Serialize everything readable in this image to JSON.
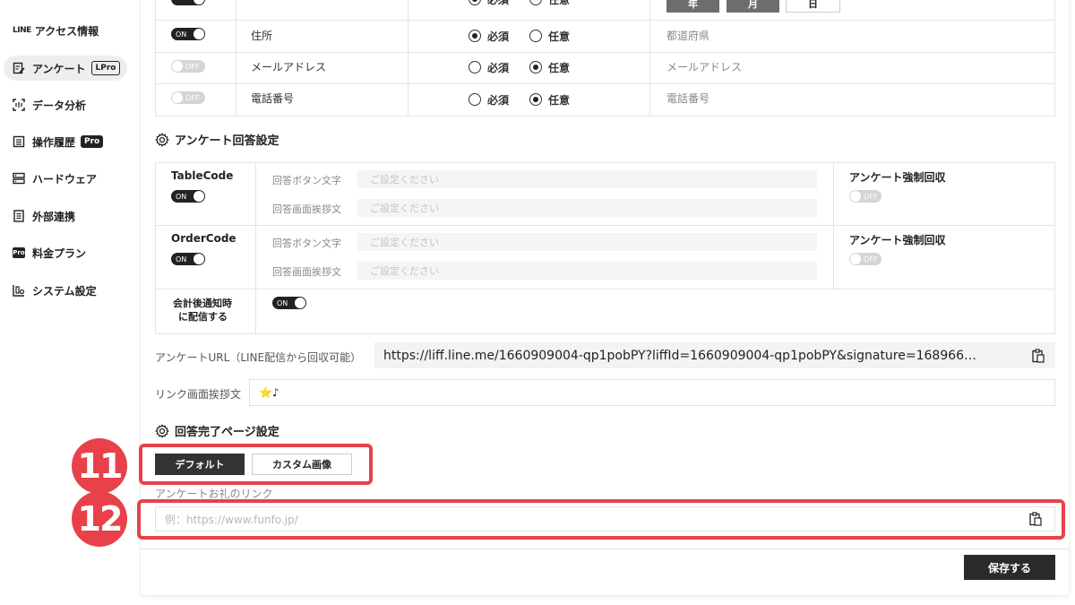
{
  "sidebar": {
    "items": [
      {
        "label": "アクセス情報",
        "logo": "LINE"
      },
      {
        "label": "アンケート",
        "badge": "LPro"
      },
      {
        "label": "データ分析"
      },
      {
        "label": "操作履歴",
        "badge": "Pro"
      },
      {
        "label": "ハードウェア"
      },
      {
        "label": "外部連携"
      },
      {
        "label": "料金プラン",
        "icon_text": "Pro"
      },
      {
        "label": "システム設定"
      }
    ]
  },
  "top_row": {
    "radio_required": "必須",
    "radio_optional": "任意",
    "btn_year": "年",
    "btn_month": "月",
    "btn_day": "日"
  },
  "fields": [
    {
      "toggle": "ON",
      "name": "住所",
      "required": "必須",
      "optional": "任意",
      "selected": "required",
      "placeholder": "都道府県"
    },
    {
      "toggle": "OFF",
      "name": "メールアドレス",
      "required": "必須",
      "optional": "任意",
      "selected": "optional",
      "placeholder": "メールアドレス"
    },
    {
      "toggle": "OFF",
      "name": "電話番号",
      "required": "必須",
      "optional": "任意",
      "selected": "optional",
      "placeholder": "電話番号"
    }
  ],
  "response_settings": {
    "title": "アンケート回答設定",
    "groups": [
      {
        "name": "TableCode",
        "toggle": "ON",
        "button_text_label": "回答ボタン文字",
        "button_text_placeholder": "ご設定ください",
        "greeting_label": "回答画面挨拶文",
        "greeting_placeholder": "ご設定ください",
        "force_label": "アンケート強制回収",
        "force_toggle": "OFF"
      },
      {
        "name": "OrderCode",
        "toggle": "ON",
        "button_text_label": "回答ボタン文字",
        "button_text_placeholder": "ご設定ください",
        "greeting_label": "回答画面挨拶文",
        "greeting_placeholder": "ご設定ください",
        "force_label": "アンケート強制回収",
        "force_toggle": "OFF"
      }
    ],
    "after_checkout_label_1": "会計後通知時",
    "after_checkout_label_2": "に配信する",
    "after_checkout_toggle": "ON"
  },
  "survey_url": {
    "label": "アンケートURL（LINE配信から回収可能）",
    "value": "https://liff.line.me/1660909004-qp1pobPY?liffId=1660909004-qp1pobPY&signature=168966…"
  },
  "link_greeting": {
    "label": "リンク画面挨拶文",
    "value": "⭐♪"
  },
  "completion_page": {
    "title": "回答完了ページ設定",
    "tab_default": "デフォルト",
    "tab_custom": "カスタム画像",
    "thanks_link_label": "アンケートお礼のリンク",
    "thanks_link_placeholder": "例：https://www.funfo.jp/"
  },
  "markers": {
    "m11": "11",
    "m12": "12"
  },
  "save_button": "保存する",
  "colors": {
    "accent_red": "#e8414a",
    "dark": "#333333"
  }
}
